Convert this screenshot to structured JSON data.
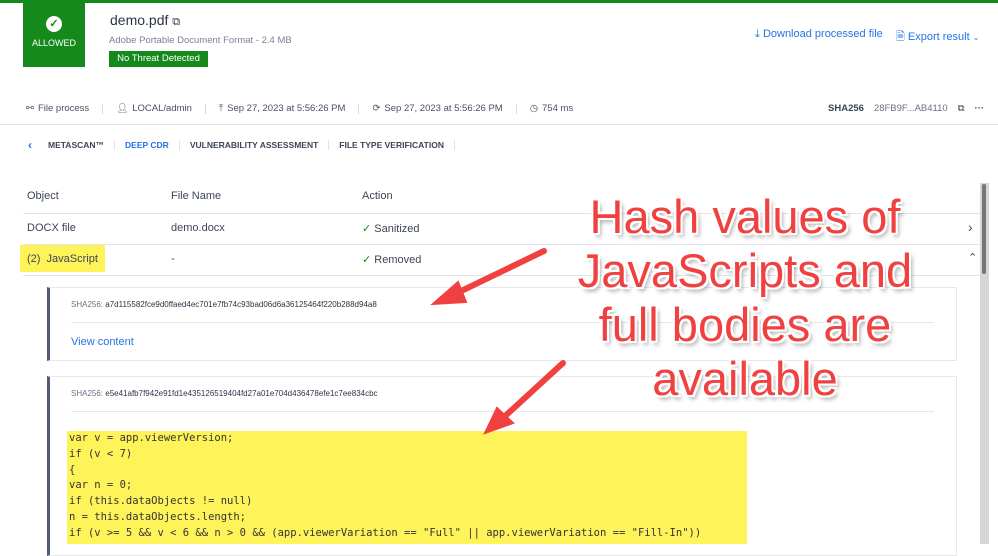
{
  "status": {
    "label": "ALLOWED",
    "badge": "No Threat Detected"
  },
  "file": {
    "name": "demo.pdf",
    "type_size": "Adobe Portable Document Format - 2.4 MB"
  },
  "actions": {
    "download": "Download processed file",
    "export": "Export result"
  },
  "meta": {
    "process": "File process",
    "user": "LOCAL/admin",
    "uploaded": "Sep 27, 2023 at 5:56:26 PM",
    "processed": "Sep 27, 2023 at 5:56:26 PM",
    "duration": "754 ms",
    "sha_label": "SHA256",
    "sha_value": "28FB9F...AB4110"
  },
  "tabs": [
    "METASCAN™",
    "DEEP CDR",
    "VULNERABILITY ASSESSMENT",
    "FILE TYPE VERIFICATION"
  ],
  "table": {
    "headers": [
      "Object",
      "File Name",
      "Action"
    ],
    "rows": [
      {
        "object": "DOCX file",
        "file": "demo.docx",
        "action": "Sanitized"
      },
      {
        "object": "(2)  JavaScript",
        "file": "-",
        "action": "Removed"
      }
    ]
  },
  "scripts": [
    {
      "label": "SHA256:",
      "hash": "a7d115582fce9d0ffaed4ec701e7fb74c93bad06d6a36125464f220b288d94a8",
      "view": "View content"
    },
    {
      "label": "SHA256:",
      "hash": "e5e41afb7f942e91fd1e435126519404fd27a01e704d436478efe1c7ee834cbc"
    }
  ],
  "code": [
    "var v = app.viewerVersion;",
    "if (v < 7)",
    "{",
    "var n = 0;",
    "if (this.dataObjects != null)",
    "n = this.dataObjects.length;",
    "if (v >= 5 && v < 6 && n > 0 && (app.viewerVariation == \"Full\" || app.viewerVariation == \"Fill-In\"))"
  ],
  "annotation": [
    "Hash values of",
    "JavaScripts and",
    "full bodies are",
    "available"
  ]
}
